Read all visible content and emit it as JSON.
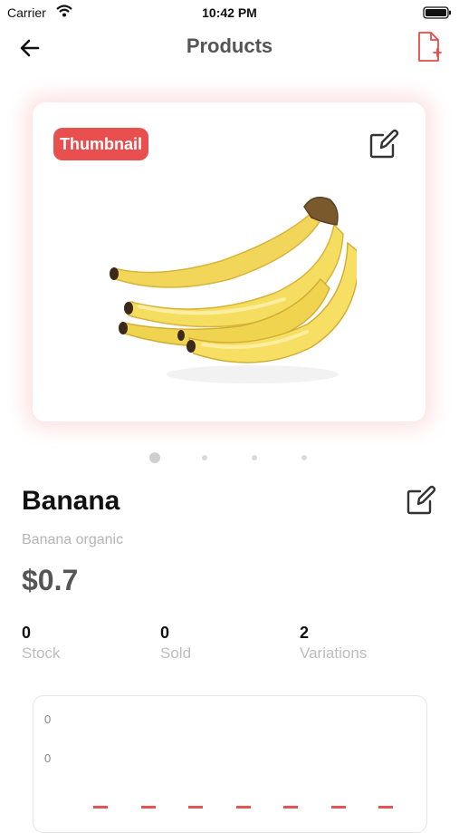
{
  "status": {
    "carrier": "Carrier",
    "time": "10:42 PM"
  },
  "header": {
    "title": "Products",
    "back_icon": "arrow-left-icon",
    "action_icon": "file-add-icon",
    "action_color": "#e84a4a"
  },
  "gallery": {
    "badge_label": "Thumbnail",
    "badge_color": "#ea4f4f",
    "edit_icon": "edit-icon",
    "image_name": "banana-bunch-image",
    "page_count": 4,
    "active_page": 1
  },
  "product": {
    "name": "Banana",
    "description": "Banana organic",
    "price": "$0.7"
  },
  "stats": [
    {
      "value": "0",
      "label": "Stock"
    },
    {
      "value": "0",
      "label": "Sold"
    },
    {
      "value": "2",
      "label": "Variations"
    }
  ],
  "chart_data": {
    "type": "bar",
    "categories": [
      "",
      "",
      "",
      "",
      "",
      "",
      ""
    ],
    "values": [
      0,
      0,
      0,
      0,
      0,
      0,
      0
    ],
    "y_tick_labels": [
      "0",
      "0"
    ],
    "color": "#e25555"
  }
}
